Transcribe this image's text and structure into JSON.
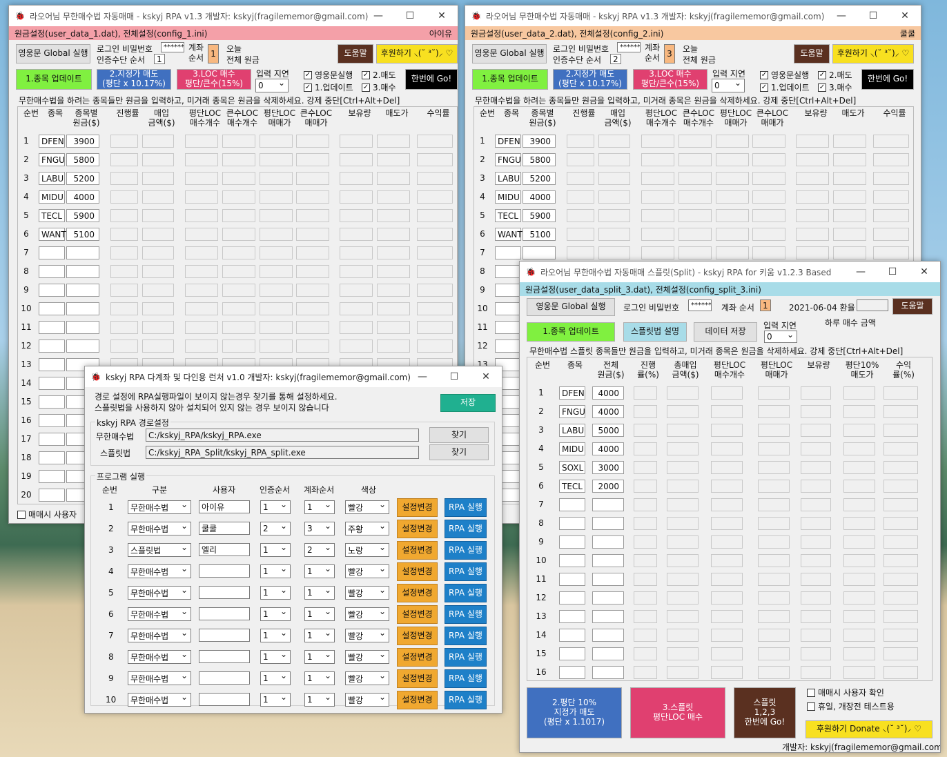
{
  "w1": {
    "title": "라오어님 무한매수법 자동매매 - kskyj RPA v1.3    개발자: kskyj(fragilememor@gmail.com)",
    "cfg": "원금설정(user_data_1.dat),  전체설정(config_1.ini)",
    "user": "아이유",
    "global": "영웅문 Global 실행",
    "login": "로그인 비밀번호",
    "pw": "******",
    "cert": "인증수단 순서",
    "cert_v": "1",
    "acct": "계좌\n순서",
    "acct_v": "1",
    "today": "오늘",
    "total": "전체 원금",
    "help": "도움말",
    "donate": "후원하기 ⸜(˘ ³˘)⸝ ♡",
    "upd": "1.종목 업데이트",
    "lim": "2.지정가 매도\n(평단 x 10.17%)",
    "loc": "3.LOC 매수\n평단/큰수(15%)",
    "delay": "입력 지연",
    "delay_v": "0",
    "c1": "영웅문실행",
    "c2": "2.매도",
    "c3": "1.업데이트",
    "c4": "3.매수",
    "go": "한번에 Go!",
    "info": "무한매수법을 하려는 종목들만 원금을 입력하고, 미거래 종목은 원금을 삭제하세요. 강제 중단[Ctrl+Alt+Del]",
    "bottom": "매매시 사용자",
    "cols": [
      "순번",
      "종목",
      "종목별\n원금($)",
      "진행률",
      "매입\n금액($)",
      "평단LOC\n매수개수",
      "큰수LOC\n매수개수",
      "평단LOC\n매매가",
      "큰수LOC\n매매가",
      "보유량",
      "매도가",
      "수익률"
    ],
    "tickers": [
      "DFEN",
      "FNGU",
      "LABU",
      "MIDU",
      "TECL",
      "WANT"
    ],
    "amts": [
      "3900",
      "5800",
      "5200",
      "4000",
      "5900",
      "5100"
    ]
  },
  "w2": {
    "title": "라오어님 무한매수법 자동매매 - kskyj RPA v1.3    개발자: kskyj(fragilememor@gmail.com)",
    "cfg": "원금설정(user_data_2.dat),  전체설정(config_2.ini)",
    "user": "쿨쿨",
    "acct_v": "3",
    "cert_v": "2",
    "tickers": [
      "DFEN",
      "FNGU",
      "LABU",
      "MIDU",
      "TECL",
      "WANT"
    ],
    "amts": [
      "3900",
      "5800",
      "5200",
      "4000",
      "5900",
      "5100"
    ]
  },
  "w3": {
    "title": "라오어님 무한매수법 자동매매 스플릿(Split) - kskyj RPA for 키움 v1.2.3 Based",
    "cfg": "원금설정(user_data_split_3.dat),  전체설정(config_split_3.ini)",
    "acct": "계좌 순서",
    "acct_v": "1",
    "date": "2021-06-04 환율",
    "split_help": "스플릿법 설명",
    "save": "데이터 저장",
    "daily": "하루 매수 금액",
    "info": "무한매수법 스플릿 종목들만 원금을 입력하고, 미거래 종목은 원금을 삭제하세요. 강제 중단[Ctrl+Alt+Del]",
    "cols": [
      "순번",
      "종목",
      "전체\n원금($)",
      "진행\n률(%)",
      "총매입\n금액($)",
      "평단LOC\n매수개수",
      "평단LOC\n매매가",
      "보유량",
      "평단10%\n매도가",
      "수익\n률(%)"
    ],
    "tickers": [
      "DFEN",
      "FNGU",
      "LABU",
      "MIDU",
      "SOXL",
      "TECL"
    ],
    "amts": [
      "4000",
      "4000",
      "5000",
      "4000",
      "3000",
      "2000"
    ],
    "b2": "2.평단 10%\n지정가 매도\n(평단 x 1.1017)",
    "b3": "3.스플릿\n평단LOC 매수",
    "b4": "스플릿\n1,2,3\n한번에 Go!",
    "chk1": "매매시 사용자 확인",
    "chk2": "휴일, 개장전 테스트용",
    "donate": "후원하기 Donate ⸜(˘ ³˘)⸝ ♡",
    "dev": "개발자: kskyj(fragilememor@gmail.com)"
  },
  "w4": {
    "title": "kskyj RPA 다계좌 및 다인용 런처 v1.0  개발자: kskyj(fragilememor@gmail.com)",
    "note": "경로 설정에 RPA실행파일이 보이지 않는경우 찾기를 통해 설정하세요.\n스플릿법을 사용하지 않아 설치되어 있지 않는 경우 보이지 않습니다",
    "save": "저장",
    "grp1": "kskyj RPA 경로설정",
    "p1l": "무한매수법",
    "p1": "C:/kskyj_RPA/kskyj_RPA.exe",
    "p2l": "스플릿법",
    "p2": "C:/kskyj_RPA_Split/kskyj_RPA_split.exe",
    "find": "찾기",
    "grp2": "프로그램 실행",
    "cols": [
      "순번",
      "구분",
      "사용자",
      "인증순서",
      "계좌순서",
      "색상"
    ],
    "rows": [
      [
        "1",
        "무한매수법",
        "아이유",
        "1",
        "1",
        "빨강"
      ],
      [
        "2",
        "무한매수법",
        "쿨쿨",
        "2",
        "3",
        "주황"
      ],
      [
        "3",
        "스플릿법",
        "엘리",
        "1",
        "2",
        "노랑"
      ],
      [
        "4",
        "무한매수법",
        "",
        "1",
        "1",
        "빨강"
      ],
      [
        "5",
        "무한매수법",
        "",
        "1",
        "1",
        "빨강"
      ],
      [
        "6",
        "무한매수법",
        "",
        "1",
        "1",
        "빨강"
      ],
      [
        "7",
        "무한매수법",
        "",
        "1",
        "1",
        "빨강"
      ],
      [
        "8",
        "무한매수법",
        "",
        "1",
        "1",
        "빨강"
      ],
      [
        "9",
        "무한매수법",
        "",
        "1",
        "1",
        "빨강"
      ],
      [
        "10",
        "무한매수법",
        "",
        "1",
        "1",
        "빨강"
      ]
    ],
    "chg": "설정변경",
    "run": "RPA 실행"
  },
  "colors": {
    "pink": "#f4a0a8",
    "orange": "#f8c8a0",
    "cyan": "#a8dce8",
    "green": "#80f040",
    "blue": "#4070c0",
    "magenta": "#e04070",
    "yellow": "#f8e020",
    "brown": "#5a3020",
    "black": "#000000",
    "teal": "#20b090",
    "gold": "#f0a830",
    "runblue": "#1e80c8"
  }
}
